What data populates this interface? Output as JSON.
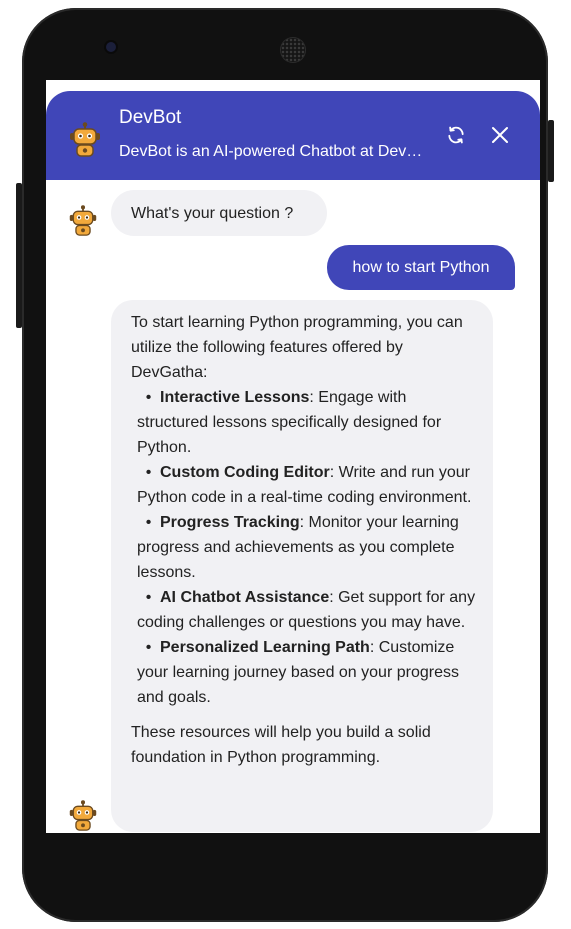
{
  "header": {
    "title": "DevBot",
    "subtitle": "DevBot is an AI-powered Chatbot at DevGatha",
    "color": "#4046b8"
  },
  "messages": {
    "bot_question": "What's your question ?",
    "user_message": "how to start Python",
    "answer": {
      "intro": "To start learning Python programming, you can utilize the following features offered by DevGatha:",
      "items": [
        {
          "bold": "Interactive Lessons",
          "text": ": Engage with structured lessons specifically designed for Python."
        },
        {
          "bold": "Custom Coding Editor",
          "text": ": Write and run your Python code in a real-time coding environment."
        },
        {
          "bold": "Progress Tracking",
          "text": ": Monitor your learning progress and achievements as you complete lessons."
        },
        {
          "bold": "AI Chatbot Assistance",
          "text": ": Get support for any coding challenges or questions you may have."
        },
        {
          "bold": "Personalized Learning Path",
          "text": ": Customize your learning journey based on your progress and goals."
        }
      ],
      "outro": "These resources will help you build a solid foundation in Python programming."
    }
  },
  "icons": {
    "avatar": "robot-icon",
    "refresh": "refresh-icon",
    "close": "close-icon"
  },
  "colors": {
    "accent": "#4046b8",
    "bot_bubble": "#f1f1f4",
    "robot_body": "#f2a93b"
  }
}
